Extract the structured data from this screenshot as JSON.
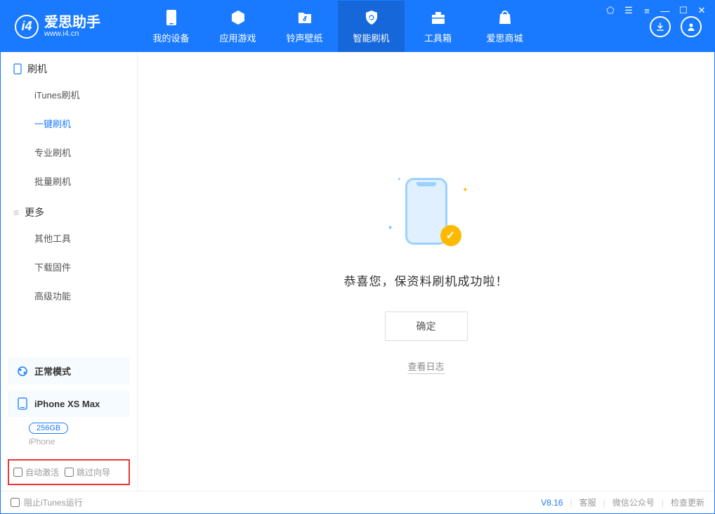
{
  "app": {
    "title": "爱思助手",
    "subtitle": "www.i4.cn"
  },
  "nav": {
    "device": "我的设备",
    "apps": "应用游戏",
    "ring": "铃声壁纸",
    "flash": "智能刷机",
    "tools": "工具箱",
    "store": "爱思商城"
  },
  "sidebar": {
    "section_flash": "刷机",
    "items_flash": {
      "itunes": "iTunes刷机",
      "oneclick": "一键刷机",
      "pro": "专业刷机",
      "batch": "批量刷机"
    },
    "section_more": "更多",
    "items_more": {
      "other": "其他工具",
      "firmware": "下载固件",
      "advanced": "高级功能"
    },
    "mode_normal": "正常模式",
    "device_name": "iPhone XS Max",
    "device_capacity": "256GB",
    "device_type": "iPhone",
    "opt_auto_activate": "自动激活",
    "opt_skip_guide": "跳过向导"
  },
  "main": {
    "success_title": "恭喜您，保资料刷机成功啦！",
    "confirm": "确定",
    "view_log": "查看日志"
  },
  "footer": {
    "stop_itunes": "阻止iTunes运行",
    "version": "V8.16",
    "service": "客服",
    "wechat": "微信公众号",
    "update": "检查更新"
  }
}
